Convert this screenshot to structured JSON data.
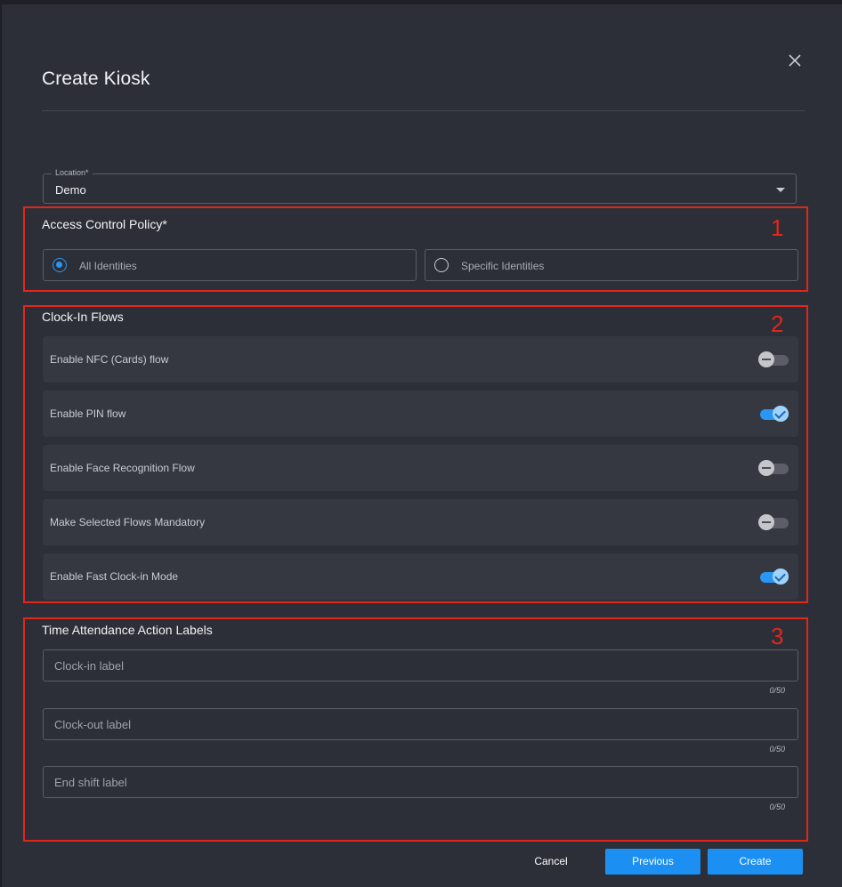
{
  "dialog": {
    "title": "Create Kiosk",
    "close_icon": "close-icon"
  },
  "location": {
    "label": "Location*",
    "value": "Demo"
  },
  "access_policy": {
    "title": "Access Control Policy*",
    "options": [
      {
        "label": "All Identities",
        "checked": true
      },
      {
        "label": "Specific Identities",
        "checked": false
      }
    ]
  },
  "clock_in_flows": {
    "title": "Clock-In Flows",
    "items": [
      {
        "label": "Enable NFC (Cards) flow",
        "enabled": false
      },
      {
        "label": "Enable PIN flow",
        "enabled": true
      },
      {
        "label": "Enable Face Recognition Flow",
        "enabled": false
      },
      {
        "label": "Make Selected Flows Mandatory",
        "enabled": false
      },
      {
        "label": "Enable Fast Clock-in Mode",
        "enabled": true
      }
    ]
  },
  "action_labels": {
    "title": "Time Attendance Action Labels",
    "fields": [
      {
        "placeholder": "Clock-in label",
        "counter": "0/50"
      },
      {
        "placeholder": "Clock-out label",
        "counter": "0/50"
      },
      {
        "placeholder": "End shift label",
        "counter": "0/50"
      }
    ]
  },
  "annotations": [
    "1",
    "2",
    "3"
  ],
  "footer": {
    "cancel": "Cancel",
    "previous": "Previous",
    "create": "Create"
  },
  "colors": {
    "accent": "#1c8ff2",
    "annotation": "#e2261b",
    "dialog_bg": "#2c2f37"
  }
}
